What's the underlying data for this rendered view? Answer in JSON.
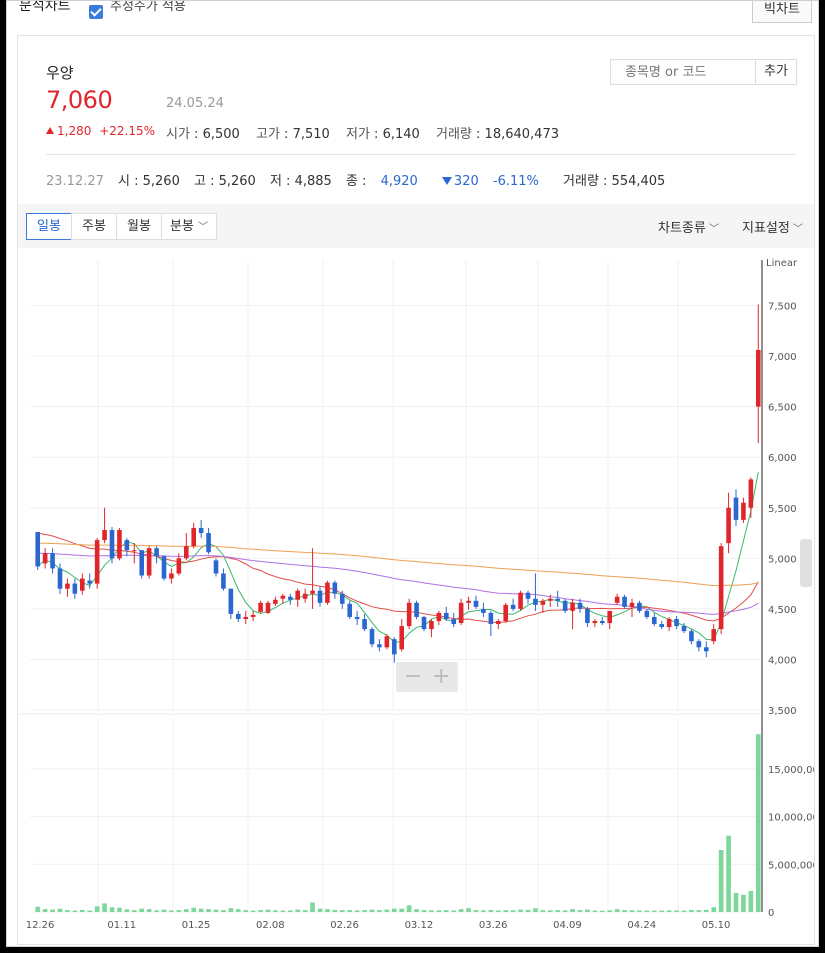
{
  "window": {
    "title": "분석차트",
    "checkbox_label": "추정주가 적용",
    "big_chart_label": "빅차트"
  },
  "stock": {
    "name": "우양",
    "price": "7,060",
    "date": "24.05.24",
    "change": "1,280",
    "change_pct": "+22.15%",
    "open_label": "시가",
    "open": "6,500",
    "high_label": "고가",
    "high": "7,510",
    "low_label": "저가",
    "low": "6,140",
    "volume_label": "거래량",
    "volume": "18,640,473"
  },
  "search": {
    "placeholder": "종목명 or 코드",
    "add_label": "추가"
  },
  "prev": {
    "date": "23.12.27",
    "open": "시 : 5,260",
    "high": "고 : 5,260",
    "low": "저 : 4,885",
    "close_label": "종 :",
    "close": "4,920",
    "change": "320",
    "change_pct": "-6.11%",
    "volume": "거래량 : 554,405"
  },
  "tabs": [
    {
      "label": "일봉",
      "active": true
    },
    {
      "label": "주봉",
      "active": false
    },
    {
      "label": "월봉",
      "active": false
    },
    {
      "label": "분봉",
      "active": false
    }
  ],
  "menus": {
    "chart_type": "차트종류",
    "indicator": "지표설정"
  },
  "colors": {
    "up": "#e0262c",
    "down": "#2a67d1",
    "ma5": "#3bb86a",
    "ma20": "#e0504a",
    "ma60": "#b170e6",
    "ma120": "#f0a050",
    "volume": "#7bd89a"
  },
  "chart_data": {
    "type": "candlestick",
    "scale_label": "Linear",
    "price_ticks": [
      "3,500",
      "4,000",
      "4,500",
      "5,000",
      "5,500",
      "6,000",
      "6,500",
      "7,000",
      "7,500"
    ],
    "volume_ticks": [
      "0",
      "5,000,000",
      "10,000,000",
      "15,000,000"
    ],
    "x_ticks": [
      "12.26",
      "01.11",
      "01.25",
      "02.08",
      "02.26",
      "03.12",
      "03.26",
      "04.09",
      "04.24",
      "05.10"
    ],
    "y_range": [
      3500,
      7950
    ],
    "candles": [
      [
        5260,
        5260,
        4885,
        4920,
        554405
      ],
      [
        4950,
        5100,
        4900,
        5050,
        300000
      ],
      [
        5050,
        5100,
        4850,
        4900,
        250000
      ],
      [
        4900,
        4950,
        4650,
        4700,
        350000
      ],
      [
        4700,
        4800,
        4620,
        4750,
        200000
      ],
      [
        4750,
        4800,
        4600,
        4650,
        150000
      ],
      [
        4680,
        4850,
        4640,
        4800,
        220000
      ],
      [
        4780,
        4850,
        4700,
        4750,
        150000
      ],
      [
        4750,
        5200,
        4700,
        5180,
        600000
      ],
      [
        5180,
        5500,
        5150,
        5280,
        900000
      ],
      [
        5280,
        5310,
        4950,
        5000,
        500000
      ],
      [
        5000,
        5300,
        4980,
        5280,
        450000
      ],
      [
        5180,
        5200,
        5020,
        5080,
        280000
      ],
      [
        5080,
        5150,
        4950,
        5080,
        200000
      ],
      [
        5080,
        5080,
        4800,
        4830,
        350000
      ],
      [
        4830,
        5120,
        4800,
        5100,
        300000
      ],
      [
        5100,
        5120,
        4950,
        5020,
        180000
      ],
      [
        5020,
        5030,
        4780,
        4800,
        250000
      ],
      [
        4800,
        4900,
        4750,
        4850,
        160000
      ],
      [
        4850,
        5050,
        4830,
        5000,
        200000
      ],
      [
        5000,
        5250,
        4980,
        5120,
        300000
      ],
      [
        5120,
        5350,
        5100,
        5300,
        450000
      ],
      [
        5300,
        5380,
        5200,
        5250,
        350000
      ],
      [
        5250,
        5300,
        5040,
        5060,
        300000
      ],
      [
        4980,
        5000,
        4820,
        4850,
        250000
      ],
      [
        4850,
        4900,
        4680,
        4700,
        200000
      ],
      [
        4700,
        4700,
        4400,
        4450,
        400000
      ],
      [
        4450,
        4480,
        4370,
        4400,
        300000
      ],
      [
        4400,
        4480,
        4350,
        4420,
        200000
      ],
      [
        4420,
        4480,
        4380,
        4440,
        150000
      ],
      [
        4470,
        4580,
        4460,
        4560,
        200000
      ],
      [
        4460,
        4580,
        4450,
        4560,
        250000
      ],
      [
        4550,
        4620,
        4530,
        4590,
        180000
      ],
      [
        4600,
        4650,
        4550,
        4630,
        150000
      ],
      [
        4620,
        4650,
        4540,
        4590,
        160000
      ],
      [
        4590,
        4700,
        4520,
        4680,
        250000
      ],
      [
        4600,
        4700,
        4560,
        4650,
        200000
      ],
      [
        4650,
        5100,
        4500,
        4680,
        1000000
      ],
      [
        4680,
        4720,
        4520,
        4560,
        350000
      ],
      [
        4560,
        4780,
        4540,
        4760,
        300000
      ],
      [
        4760,
        4780,
        4600,
        4650,
        220000
      ],
      [
        4650,
        4680,
        4500,
        4550,
        200000
      ],
      [
        4550,
        4580,
        4400,
        4420,
        200000
      ],
      [
        4420,
        4480,
        4340,
        4400,
        180000
      ],
      [
        4400,
        4450,
        4280,
        4300,
        200000
      ],
      [
        4300,
        4320,
        4120,
        4150,
        250000
      ],
      [
        4150,
        4200,
        4080,
        4120,
        200000
      ],
      [
        4120,
        4250,
        4100,
        4230,
        250000
      ],
      [
        4200,
        4220,
        3970,
        4050,
        350000
      ],
      [
        4100,
        4400,
        4080,
        4330,
        350000
      ],
      [
        4330,
        4600,
        4300,
        4560,
        700000
      ],
      [
        4560,
        4580,
        4400,
        4420,
        300000
      ],
      [
        4420,
        4430,
        4280,
        4300,
        200000
      ],
      [
        4300,
        4400,
        4220,
        4380,
        180000
      ],
      [
        4380,
        4480,
        4340,
        4460,
        180000
      ],
      [
        4460,
        4520,
        4380,
        4400,
        200000
      ],
      [
        4400,
        4460,
        4320,
        4350,
        160000
      ],
      [
        4360,
        4600,
        4340,
        4560,
        300000
      ],
      [
        4560,
        4620,
        4490,
        4580,
        400000
      ],
      [
        4580,
        4630,
        4500,
        4520,
        200000
      ],
      [
        4500,
        4560,
        4420,
        4460,
        180000
      ],
      [
        4460,
        4480,
        4230,
        4350,
        220000
      ],
      [
        4350,
        4400,
        4300,
        4380,
        160000
      ],
      [
        4380,
        4560,
        4360,
        4540,
        200000
      ],
      [
        4540,
        4600,
        4480,
        4500,
        180000
      ],
      [
        4500,
        4680,
        4480,
        4660,
        250000
      ],
      [
        4660,
        4680,
        4550,
        4600,
        220000
      ],
      [
        4600,
        4850,
        4480,
        4540,
        400000
      ],
      [
        4540,
        4600,
        4460,
        4580,
        200000
      ],
      [
        4580,
        4640,
        4520,
        4600,
        180000
      ],
      [
        4600,
        4680,
        4520,
        4580,
        200000
      ],
      [
        4580,
        4600,
        4460,
        4480,
        180000
      ],
      [
        4480,
        4600,
        4300,
        4560,
        300000
      ],
      [
        4560,
        4600,
        4460,
        4500,
        200000
      ],
      [
        4500,
        4520,
        4320,
        4360,
        250000
      ],
      [
        4360,
        4400,
        4320,
        4380,
        150000
      ],
      [
        4380,
        4420,
        4340,
        4360,
        140000
      ],
      [
        4360,
        4400,
        4300,
        4480,
        180000
      ],
      [
        4560,
        4650,
        4540,
        4620,
        300000
      ],
      [
        4620,
        4640,
        4500,
        4520,
        200000
      ],
      [
        4520,
        4600,
        4420,
        4560,
        180000
      ],
      [
        4560,
        4580,
        4460,
        4480,
        160000
      ],
      [
        4480,
        4500,
        4400,
        4420,
        160000
      ],
      [
        4420,
        4460,
        4330,
        4350,
        150000
      ],
      [
        4350,
        4380,
        4300,
        4320,
        150000
      ],
      [
        4320,
        4420,
        4280,
        4400,
        180000
      ],
      [
        4400,
        4430,
        4300,
        4330,
        160000
      ],
      [
        4330,
        4360,
        4260,
        4280,
        150000
      ],
      [
        4280,
        4300,
        4150,
        4180,
        220000
      ],
      [
        4180,
        4200,
        4080,
        4120,
        200000
      ],
      [
        4120,
        4180,
        4020,
        4080,
        220000
      ],
      [
        4180,
        4350,
        4150,
        4300,
        500000
      ],
      [
        4300,
        5150,
        4250,
        5120,
        6500000
      ],
      [
        5150,
        5650,
        5050,
        5500,
        8000000
      ],
      [
        5600,
        5680,
        5320,
        5380,
        2000000
      ],
      [
        5380,
        5600,
        5350,
        5550,
        1800000
      ],
      [
        5500,
        5800,
        5400,
        5780,
        2200000
      ],
      [
        6500,
        7510,
        6140,
        7060,
        18640473
      ]
    ]
  }
}
